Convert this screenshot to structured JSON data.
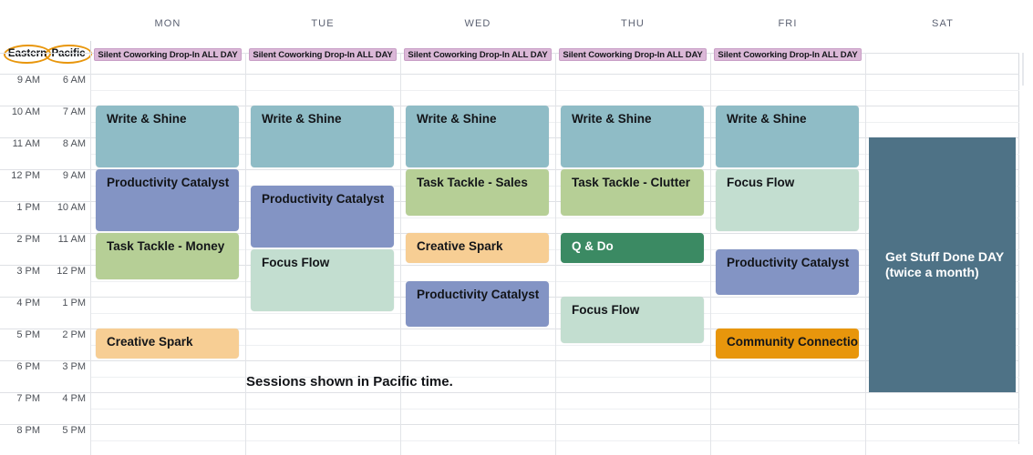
{
  "header": {
    "days": [
      "MON",
      "TUE",
      "WED",
      "THU",
      "FRI",
      "SAT"
    ]
  },
  "timezones": {
    "eastern_label": "Eastern",
    "pacific_label": "Pacific",
    "eastern_times": [
      "9 AM",
      "10 AM",
      "11 AM",
      "12 PM",
      "1 PM",
      "2 PM",
      "3 PM",
      "4 PM",
      "5 PM",
      "6 PM",
      "7 PM",
      "8 PM"
    ],
    "pacific_times": [
      "6 AM",
      "7 AM",
      "8 AM",
      "9 AM",
      "10 AM",
      "11 AM",
      "12 PM",
      "1 PM",
      "2 PM",
      "3 PM",
      "4 PM",
      "5 PM"
    ]
  },
  "allday": {
    "label": "Silent Coworking Drop-In ALL DAY",
    "days": [
      "MON",
      "TUE",
      "WED",
      "THU",
      "FRI"
    ]
  },
  "footnote": "Sessions shown in Pacific time.",
  "colors": {
    "write_shine": "#8fbcc6",
    "productivity_catalyst": "#8394c4",
    "task_tackle": "#b6cf96",
    "creative_spark": "#f7ce94",
    "focus_flow": "#c3ded0",
    "q_and_do": "#3b8a63",
    "community_connection": "#e8960c",
    "silent_coworking": "#dbb8d7",
    "get_stuff_done": "#4e7286",
    "annotation_ellipse": "#e8960c"
  },
  "events": [
    {
      "day": "MON",
      "title": "Write & Shine",
      "start_eastern": "10 AM",
      "end_eastern": "12 PM",
      "color_key": "write_shine"
    },
    {
      "day": "MON",
      "title": "Productivity Catalyst",
      "start_eastern": "12 PM",
      "end_eastern": "2 PM",
      "color_key": "productivity_catalyst"
    },
    {
      "day": "MON",
      "title": "Task Tackle - Money",
      "start_eastern": "2 PM",
      "end_eastern": "3:30 PM",
      "color_key": "task_tackle"
    },
    {
      "day": "MON",
      "title": "Creative Spark",
      "start_eastern": "5 PM",
      "end_eastern": "6 PM",
      "color_key": "creative_spark"
    },
    {
      "day": "TUE",
      "title": "Write & Shine",
      "start_eastern": "10 AM",
      "end_eastern": "12 PM",
      "color_key": "write_shine"
    },
    {
      "day": "TUE",
      "title": "Productivity Catalyst",
      "start_eastern": "12:30 PM",
      "end_eastern": "2:30 PM",
      "color_key": "productivity_catalyst"
    },
    {
      "day": "TUE",
      "title": "Focus Flow",
      "start_eastern": "2:30 PM",
      "end_eastern": "4:30 PM",
      "color_key": "focus_flow"
    },
    {
      "day": "WED",
      "title": "Write & Shine",
      "start_eastern": "10 AM",
      "end_eastern": "12 PM",
      "color_key": "write_shine"
    },
    {
      "day": "WED",
      "title": "Task Tackle - Sales",
      "start_eastern": "12 PM",
      "end_eastern": "1:30 PM",
      "color_key": "task_tackle"
    },
    {
      "day": "WED",
      "title": "Creative Spark",
      "start_eastern": "2 PM",
      "end_eastern": "3 PM",
      "color_key": "creative_spark"
    },
    {
      "day": "WED",
      "title": "Productivity Catalyst",
      "start_eastern": "3:30 PM",
      "end_eastern": "5 PM",
      "color_key": "productivity_catalyst"
    },
    {
      "day": "THU",
      "title": "Write & Shine",
      "start_eastern": "10 AM",
      "end_eastern": "12 PM",
      "color_key": "write_shine"
    },
    {
      "day": "THU",
      "title": "Task Tackle - Clutter",
      "start_eastern": "12 PM",
      "end_eastern": "1:30 PM",
      "color_key": "task_tackle"
    },
    {
      "day": "THU",
      "title": "Q & Do",
      "start_eastern": "2 PM",
      "end_eastern": "3 PM",
      "color_key": "q_and_do"
    },
    {
      "day": "THU",
      "title": "Focus Flow",
      "start_eastern": "4 PM",
      "end_eastern": "5:30 PM",
      "color_key": "focus_flow"
    },
    {
      "day": "FRI",
      "title": "Write & Shine",
      "start_eastern": "10 AM",
      "end_eastern": "12 PM",
      "color_key": "write_shine"
    },
    {
      "day": "FRI",
      "title": "Focus Flow",
      "start_eastern": "12 PM",
      "end_eastern": "2 PM",
      "color_key": "focus_flow"
    },
    {
      "day": "FRI",
      "title": "Productivity Catalyst",
      "start_eastern": "2:30 PM",
      "end_eastern": "4 PM",
      "color_key": "productivity_catalyst"
    },
    {
      "day": "FRI",
      "title": "Community Connection",
      "start_eastern": "5 PM",
      "end_eastern": "6 PM",
      "color_key": "community_connection"
    }
  ],
  "saturday_event": {
    "day": "SAT",
    "title_line1": "Get Stuff Done DAY",
    "title_line2": "(twice a month)",
    "start_eastern": "11 AM",
    "end_eastern": "7 PM",
    "color_key": "get_stuff_done"
  }
}
